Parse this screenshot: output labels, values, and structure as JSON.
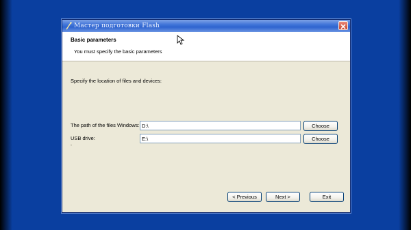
{
  "window": {
    "title": "Мастер подготовки Flash"
  },
  "header": {
    "title": "Basic parameters",
    "subtitle": "You must specify the basic parameters"
  },
  "content": {
    "instruction": "Specify the location of files and devices:",
    "rows": [
      {
        "label": "The path of the files Windows:",
        "value": "D:\\",
        "button": "Choose"
      },
      {
        "label": "USB drive:",
        "value": "E:\\",
        "button": "Choose"
      }
    ]
  },
  "footer": {
    "previous": "< Previous",
    "next": "Next >",
    "exit": "Exit"
  },
  "colors": {
    "desktop": "#0a3fa0",
    "titlebar": "#2f64cf",
    "close": "#c9452c",
    "dialog": "#ece9d8"
  }
}
